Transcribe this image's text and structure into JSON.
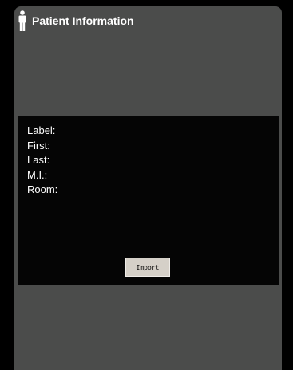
{
  "header": {
    "title": "Patient Information",
    "icon": "person-icon"
  },
  "patient_fields": [
    {
      "label": "Label:",
      "value": ""
    },
    {
      "label": "First:",
      "value": ""
    },
    {
      "label": "Last:",
      "value": ""
    },
    {
      "label": "M.I.:",
      "value": ""
    },
    {
      "label": "Room:",
      "value": ""
    }
  ],
  "actions": {
    "import_label": "Import"
  },
  "colors": {
    "background": "#000000",
    "panel": "#4b4c4b",
    "info_box": "#050505",
    "button": "#d5d0c8",
    "text": "#ffffff"
  }
}
